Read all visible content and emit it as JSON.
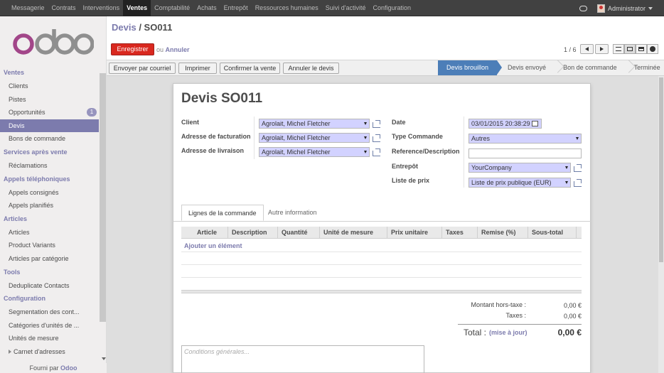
{
  "topbar": {
    "menu": [
      "Messagerie",
      "Contrats",
      "Interventions",
      "Ventes",
      "Comptabilité",
      "Achats",
      "Entrepôt",
      "Ressources humaines",
      "Suivi d'activité",
      "Configuration"
    ],
    "active_index": 3,
    "user": "Administrator"
  },
  "logo_text": "odoo",
  "sidebar": {
    "sections": [
      {
        "title": "Ventes",
        "items": [
          {
            "label": "Clients"
          },
          {
            "label": "Pistes"
          },
          {
            "label": "Opportunités",
            "badge": "1"
          },
          {
            "label": "Devis",
            "active": true
          },
          {
            "label": "Bons de commande"
          }
        ]
      },
      {
        "title": "Services après vente",
        "items": [
          {
            "label": "Réclamations"
          }
        ]
      },
      {
        "title": "Appels téléphoniques",
        "items": [
          {
            "label": "Appels consignés"
          },
          {
            "label": "Appels planifiés"
          }
        ]
      },
      {
        "title": "Articles",
        "items": [
          {
            "label": "Articles"
          },
          {
            "label": "Product Variants"
          },
          {
            "label": "Articles par catégorie"
          }
        ]
      },
      {
        "title": "Tools",
        "items": [
          {
            "label": "Deduplicate Contacts"
          }
        ]
      },
      {
        "title": "Configuration",
        "items": [
          {
            "label": "Segmentation des cont..."
          },
          {
            "label": "Catégories d'unités de ..."
          },
          {
            "label": "Unités de mesure"
          },
          {
            "label": "Carnet d'adresses",
            "expandable": true
          }
        ]
      }
    ],
    "powered_by": "Fourni par",
    "powered_brand": "Odoo"
  },
  "breadcrumb": {
    "parent": "Devis",
    "sep": " / ",
    "current": "SO011"
  },
  "actions": {
    "save": "Enregistrer",
    "or": "ou",
    "discard": "Annuler"
  },
  "pager": "1 / 6",
  "header_buttons": [
    "Envoyer par courriel",
    "Imprimer",
    "Confirmer la vente",
    "Annuler le devis"
  ],
  "statusbar": [
    "Devis brouillon",
    "Devis envoyé",
    "Bon de commande",
    "Terminée"
  ],
  "status_current": 0,
  "form": {
    "title": "Devis SO011",
    "left": [
      {
        "label": "Client",
        "value": "Agrolait, Michel Fletcher"
      },
      {
        "label": "Adresse de facturation",
        "value": "Agrolait, Michel Fletcher"
      },
      {
        "label": "Adresse de livraison",
        "value": "Agrolait, Michel Fletcher"
      }
    ],
    "right": [
      {
        "label": "Date",
        "value": "03/01/2015 20:38:29"
      },
      {
        "label": "Type Commande",
        "value": "Autres"
      },
      {
        "label": "Reference/Description",
        "value": ""
      },
      {
        "label": "Entrepôt",
        "value": "YourCompany"
      },
      {
        "label": "Liste de prix",
        "value": "Liste de prix publique (EUR)"
      }
    ]
  },
  "tabs": [
    "Lignes de la commande",
    "Autre information"
  ],
  "active_tab": 0,
  "table": {
    "columns": [
      "Article",
      "Description",
      "Quantité",
      "Unité de mesure",
      "Prix unitaire",
      "Taxes",
      "Remise (%)",
      "Sous-total"
    ],
    "add_item": "Ajouter un élément"
  },
  "totals": {
    "untaxed_label": "Montant hors-taxe :",
    "untaxed": "0,00 €",
    "taxes_label": "Taxes :",
    "taxes": "0,00 €",
    "total_label": "Total :",
    "update": "(mise à jour)",
    "total": "0,00 €"
  },
  "notes_placeholder": "Conditions générales...",
  "colors": {
    "accent": "#7c7bad",
    "save": "#d9281f",
    "status": "#4c7eb8"
  }
}
